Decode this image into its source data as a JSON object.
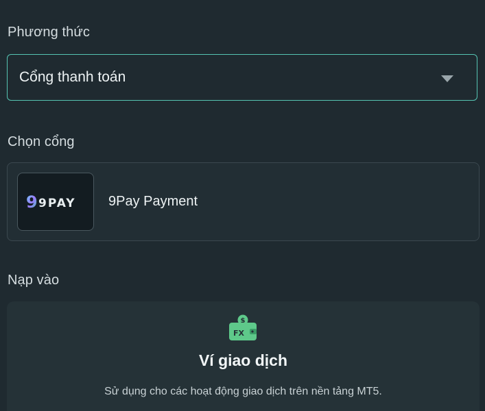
{
  "method": {
    "label": "Phương thức",
    "selected": "Cổng thanh toán"
  },
  "gate": {
    "label": "Chọn cổng",
    "logo_text": "9PAY",
    "name": "9Pay Payment"
  },
  "deposit": {
    "label": "Nạp vào",
    "icon": "fx-wallet-icon",
    "icon_text": "FX",
    "title": "Ví giao dịch",
    "description": "Sử dụng cho các hoạt động giao dịch trên nền tảng MT5."
  },
  "colors": {
    "background": "#1f2a30",
    "accent": "#56c5b3",
    "wallet_green": "#5ec98a"
  }
}
